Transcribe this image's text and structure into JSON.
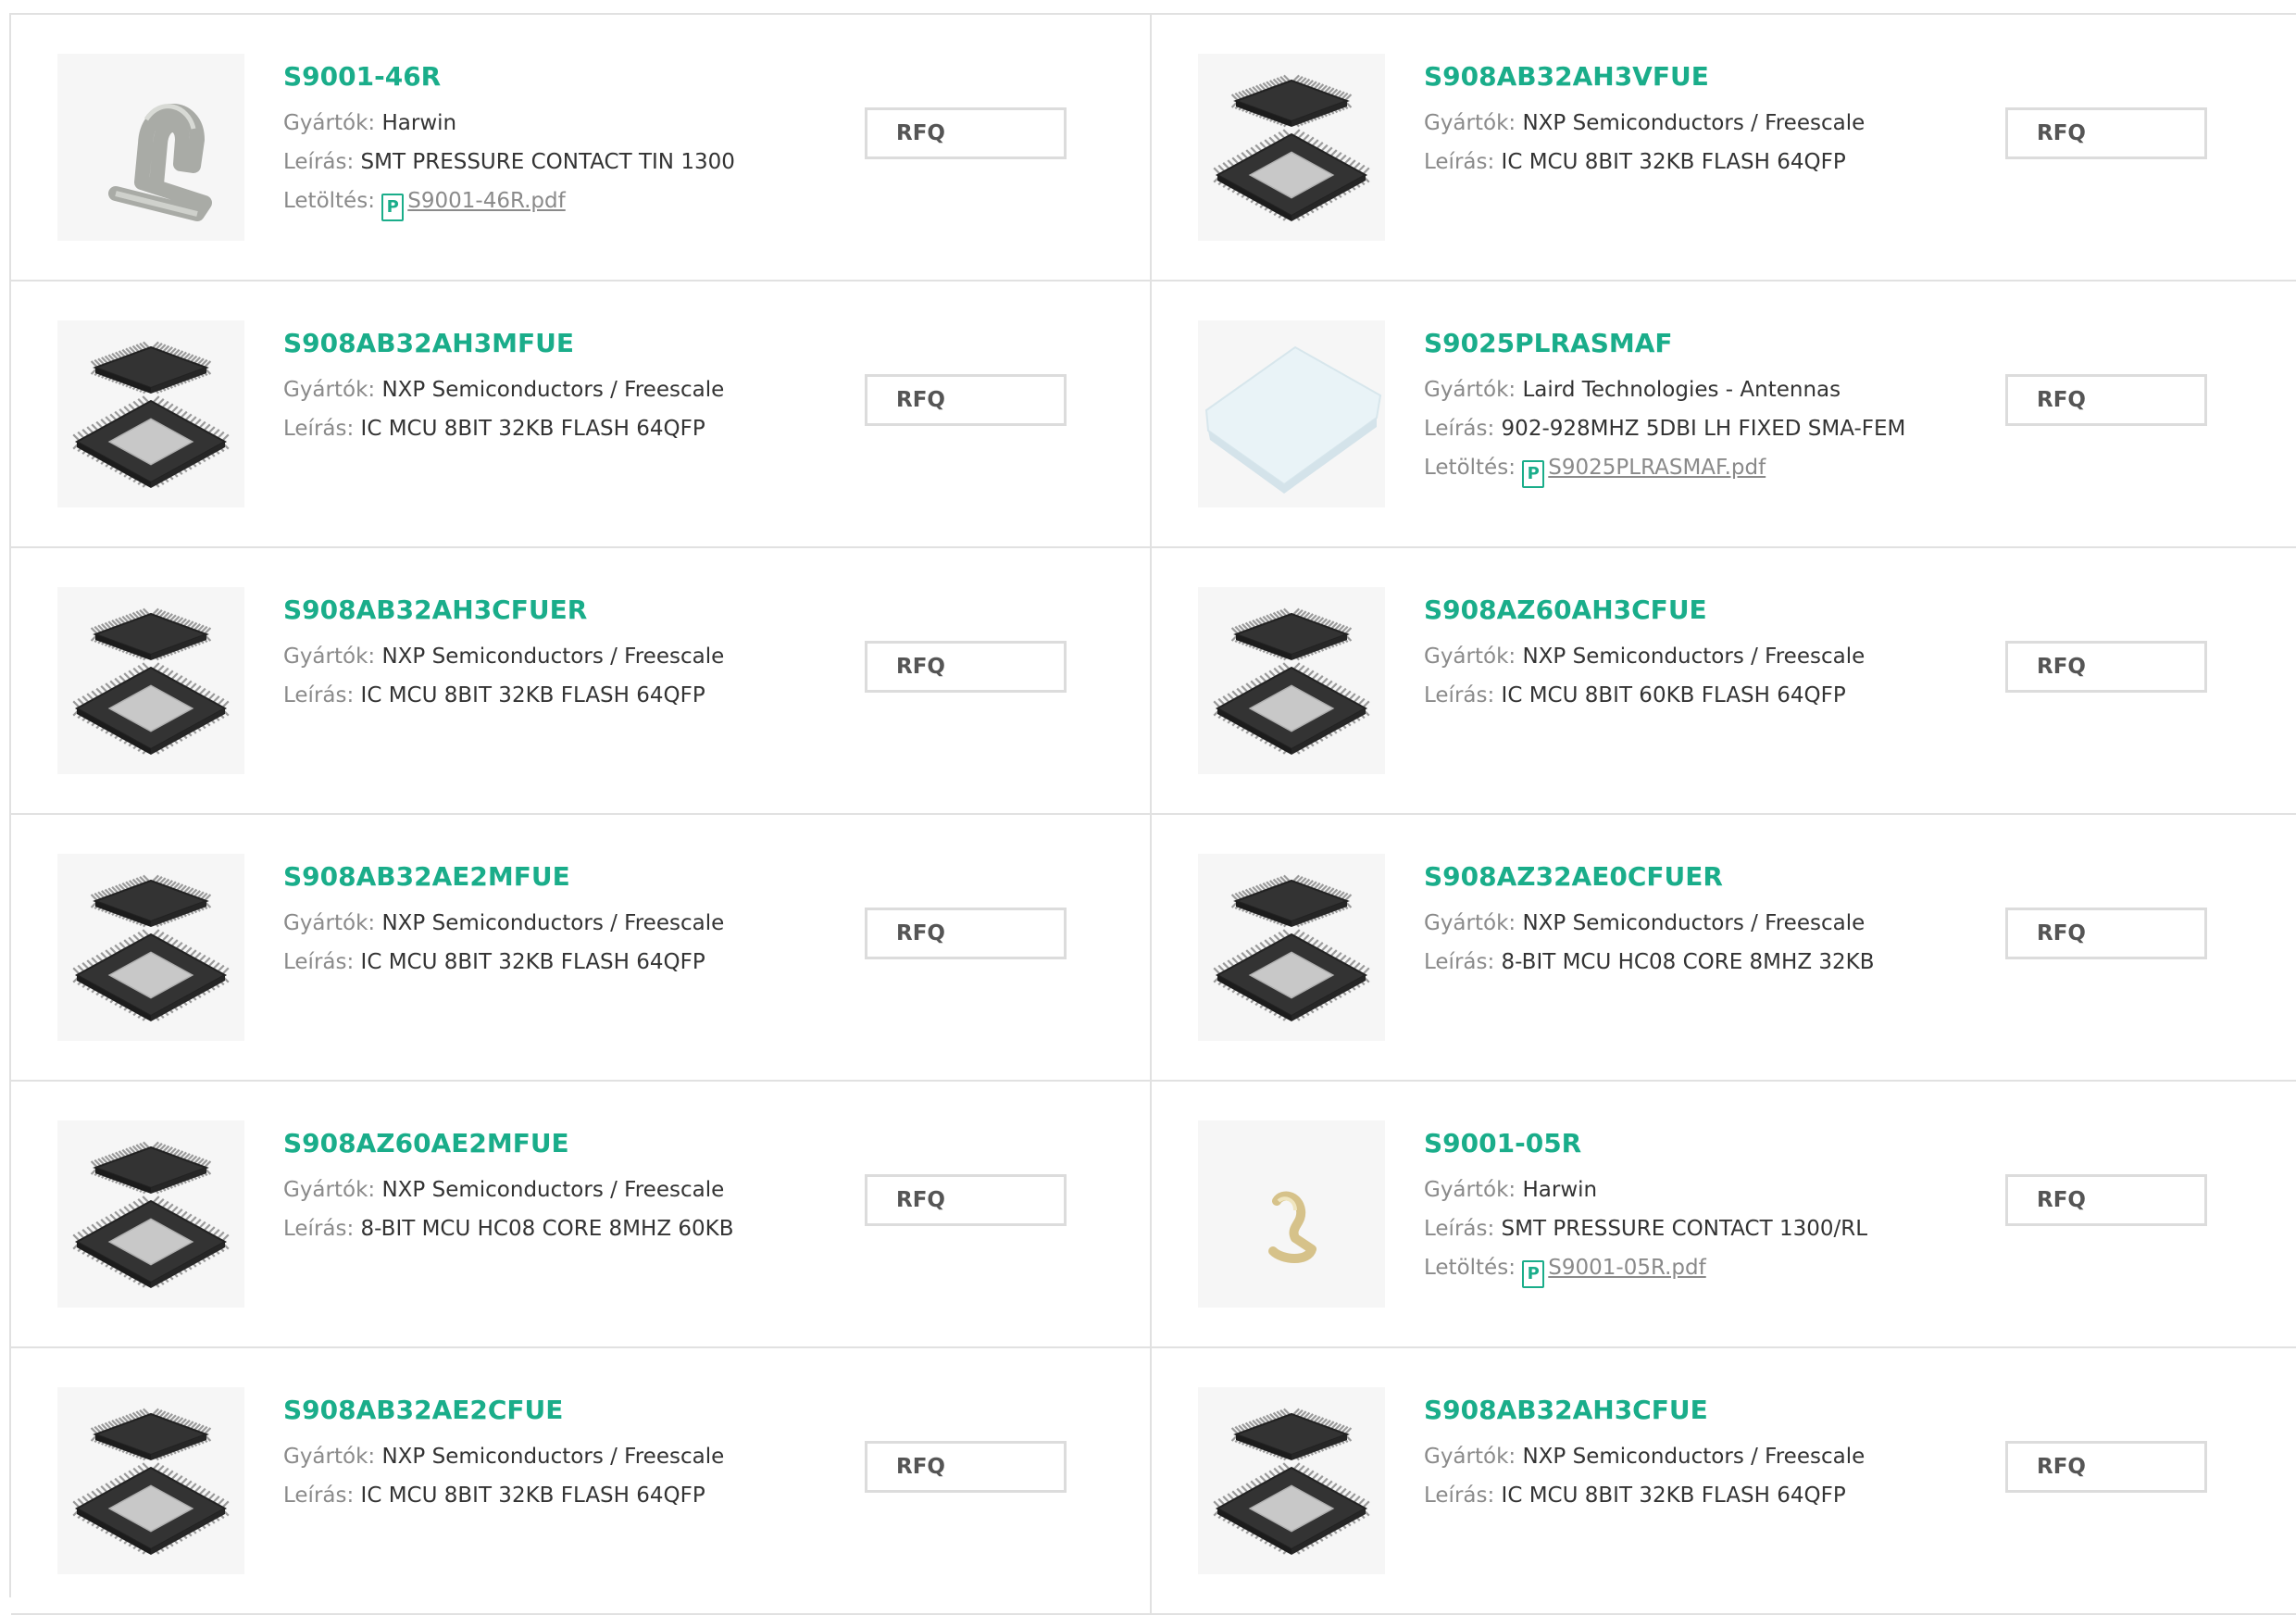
{
  "labels": {
    "manufacturer": "Gyártók:",
    "description": "Leírás:",
    "download": "Letöltés:",
    "pdf_glyph": "P",
    "rfq": "RFQ"
  },
  "colors": {
    "accent": "#1aad8a",
    "label": "#8a8a8a",
    "text": "#333333",
    "border": "#e1e1e1"
  },
  "products": [
    {
      "part": "S9001-46R",
      "manufacturer": "Harwin",
      "description": "SMT PRESSURE CONTACT TIN 1300",
      "download": "S9001-46R.pdf",
      "image": "spring-contact-tin"
    },
    {
      "part": "S908AB32AH3VFUE",
      "manufacturer": "NXP Semiconductors / Freescale",
      "description": "IC MCU 8BIT 32KB FLASH 64QFP",
      "download": "",
      "image": "qfp-chip"
    },
    {
      "part": "S908AB32AH3MFUE",
      "manufacturer": "NXP Semiconductors / Freescale",
      "description": "IC MCU 8BIT 32KB FLASH 64QFP",
      "download": "",
      "image": "qfp-chip"
    },
    {
      "part": "S9025PLRASMAF",
      "manufacturer": "Laird Technologies - Antennas",
      "description": "902-928MHZ 5DBI LH FIXED SMA-FEM",
      "download": "S9025PLRASMAF.pdf",
      "image": "antenna-panel"
    },
    {
      "part": "S908AB32AH3CFUER",
      "manufacturer": "NXP Semiconductors / Freescale",
      "description": "IC MCU 8BIT 32KB FLASH 64QFP",
      "download": "",
      "image": "qfp-chip"
    },
    {
      "part": "S908AZ60AH3CFUE",
      "manufacturer": "NXP Semiconductors / Freescale",
      "description": "IC MCU 8BIT 60KB FLASH 64QFP",
      "download": "",
      "image": "qfp-chip"
    },
    {
      "part": "S908AB32AE2MFUE",
      "manufacturer": "NXP Semiconductors / Freescale",
      "description": "IC MCU 8BIT 32KB FLASH 64QFP",
      "download": "",
      "image": "qfp-chip"
    },
    {
      "part": "S908AZ32AE0CFUER",
      "manufacturer": "NXP Semiconductors / Freescale",
      "description": "8-BIT MCU HC08 CORE 8MHZ 32KB",
      "download": "",
      "image": "qfp-chip"
    },
    {
      "part": "S908AZ60AE2MFUE",
      "manufacturer": "NXP Semiconductors / Freescale",
      "description": "8-BIT MCU HC08 CORE 8MHZ 60KB",
      "download": "",
      "image": "qfp-chip"
    },
    {
      "part": "S9001-05R",
      "manufacturer": "Harwin",
      "description": "SMT PRESSURE CONTACT 1300/RL",
      "download": "S9001-05R.pdf",
      "image": "spring-contact-gold"
    },
    {
      "part": "S908AB32AE2CFUE",
      "manufacturer": "NXP Semiconductors / Freescale",
      "description": "IC MCU 8BIT 32KB FLASH 64QFP",
      "download": "",
      "image": "qfp-chip"
    },
    {
      "part": "S908AB32AH3CFUE",
      "manufacturer": "NXP Semiconductors / Freescale",
      "description": "IC MCU 8BIT 32KB FLASH 64QFP",
      "download": "",
      "image": "qfp-chip"
    }
  ]
}
